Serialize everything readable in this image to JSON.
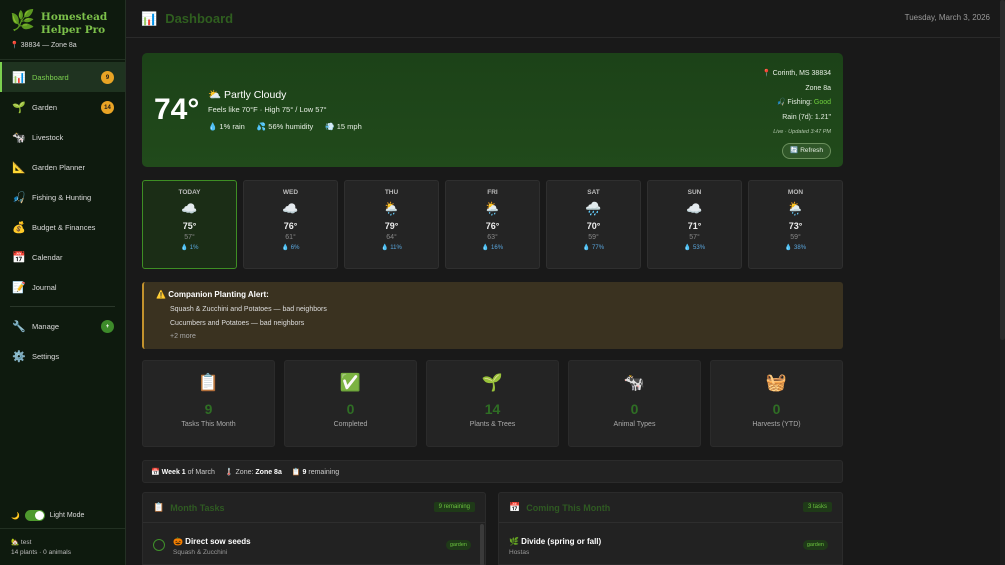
{
  "app": {
    "name_line1": "Homestead",
    "name_line2": "Helper Pro",
    "location": "📍 38834 — Zone 8a"
  },
  "nav": [
    {
      "icon": "📊",
      "label": "Dashboard",
      "badge": "9"
    },
    {
      "icon": "🌱",
      "label": "Garden",
      "badge": "14"
    },
    {
      "icon": "🐄",
      "label": "Livestock"
    },
    {
      "icon": "📐",
      "label": "Garden Planner"
    },
    {
      "icon": "🎣",
      "label": "Fishing & Hunting"
    },
    {
      "icon": "💰",
      "label": "Budget & Finances"
    },
    {
      "icon": "📅",
      "label": "Calendar"
    },
    {
      "icon": "📝",
      "label": "Journal"
    }
  ],
  "nav_bottom": [
    {
      "icon": "🔧",
      "label": "Manage",
      "badge": "+"
    },
    {
      "icon": "⚙️",
      "label": "Settings"
    }
  ],
  "theme": {
    "label": "Light Mode",
    "on": true
  },
  "user": {
    "name": "🏡 test",
    "summary": "14 plants · 0 animals"
  },
  "header": {
    "title": "Dashboard",
    "date": "Tuesday, March 3, 2026"
  },
  "weather": {
    "temp": "74°",
    "condition": "⛅ Partly Cloudy",
    "feels": "Feels like 70°F · High 75° / Low 57°",
    "rain": "💧 1% rain",
    "humidity": "💦 56% humidity",
    "wind": "💨 15 mph",
    "location": "📍 Corinth, MS 38834",
    "zone": "Zone 8a",
    "fishing_label": "🎣 Fishing:",
    "fishing_value": "Good",
    "rain7": "Rain (7d): 1.21\"",
    "updated": "Live · Updated 3:47 PM",
    "refresh": "🔄 Refresh"
  },
  "forecast": [
    {
      "day": "TODAY",
      "icon": "☁️",
      "high": "75°",
      "low": "57°",
      "rain": "💧 1%"
    },
    {
      "day": "WED",
      "icon": "☁️",
      "high": "76°",
      "low": "61°",
      "rain": "💧 6%"
    },
    {
      "day": "THU",
      "icon": "🌦️",
      "high": "79°",
      "low": "64°",
      "rain": "💧 11%"
    },
    {
      "day": "FRI",
      "icon": "🌦️",
      "high": "76°",
      "low": "63°",
      "rain": "💧 16%"
    },
    {
      "day": "SAT",
      "icon": "🌧️",
      "high": "70°",
      "low": "59°",
      "rain": "💧 77%"
    },
    {
      "day": "SUN",
      "icon": "☁️",
      "high": "71°",
      "low": "57°",
      "rain": "💧 53%"
    },
    {
      "day": "MON",
      "icon": "🌦️",
      "high": "73°",
      "low": "59°",
      "rain": "💧 38%"
    }
  ],
  "alert": {
    "icon": "⚠️",
    "title": "Companion Planting Alert:",
    "lines": [
      "Squash & Zucchini and Potatoes — bad neighbors",
      "Cucumbers and Potatoes — bad neighbors"
    ],
    "more": "+2 more"
  },
  "stats": [
    {
      "icon": "📋",
      "value": "9",
      "label": "Tasks This Month"
    },
    {
      "icon": "✅",
      "value": "0",
      "label": "Completed"
    },
    {
      "icon": "🌱",
      "value": "14",
      "label": "Plants & Trees"
    },
    {
      "icon": "🐄",
      "value": "0",
      "label": "Animal Types"
    },
    {
      "icon": "🧺",
      "value": "0",
      "label": "Harvests (YTD)"
    }
  ],
  "week": {
    "icon": "📅",
    "week": "Week 1",
    "of": "of March",
    "zone_icon": "🌡️",
    "zone_label": "Zone:",
    "zone": "Zone 8a",
    "rem_icon": "📋",
    "remaining": "9",
    "remaining_label": "remaining"
  },
  "panels": {
    "left": {
      "icon": "📋",
      "title": "Month Tasks",
      "pill": "9 remaining",
      "task": {
        "title": "🎃 Direct sow seeds",
        "sub": "Squash & Zucchini",
        "tag": "garden"
      }
    },
    "right": {
      "icon": "📅",
      "title": "Coming This Month",
      "pill": "3 tasks",
      "task": {
        "title": "🌿 Divide (spring or fall)",
        "sub": "Hostas",
        "tag": "garden"
      }
    }
  }
}
